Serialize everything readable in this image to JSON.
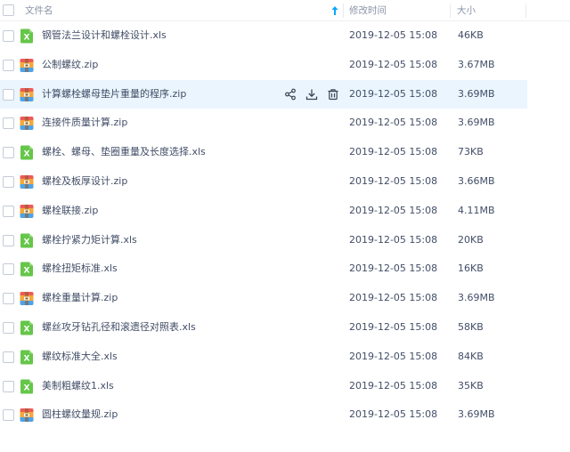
{
  "header": {
    "name_label": "文件名",
    "time_label": "修改时间",
    "size_label": "大小",
    "sort_icon": "sort-ascending-arrow-icon",
    "accent_color": "#06a7ff"
  },
  "icons": {
    "xls": {
      "letter": "X",
      "color": "#65c649"
    },
    "zip": {
      "color": "#f3a83b"
    }
  },
  "files": [
    {
      "name": "钢管法兰设计和螺栓设计.xls",
      "type": "xls",
      "modified": "2019-12-05 15:08",
      "size": "46KB"
    },
    {
      "name": "公制螺纹.zip",
      "type": "zip",
      "modified": "2019-12-05 15:08",
      "size": "3.67MB"
    },
    {
      "name": "计算螺栓螺母垫片重量的程序.zip",
      "type": "zip",
      "modified": "2019-12-05 15:08",
      "size": "3.69MB",
      "hover": true
    },
    {
      "name": "连接件质量计算.zip",
      "type": "zip",
      "modified": "2019-12-05 15:08",
      "size": "3.69MB"
    },
    {
      "name": "螺栓、螺母、垫圈重量及长度选择.xls",
      "type": "xls",
      "modified": "2019-12-05 15:08",
      "size": "73KB"
    },
    {
      "name": "螺栓及板厚设计.zip",
      "type": "zip",
      "modified": "2019-12-05 15:08",
      "size": "3.66MB"
    },
    {
      "name": "螺栓联接.zip",
      "type": "zip",
      "modified": "2019-12-05 15:08",
      "size": "4.11MB"
    },
    {
      "name": "螺栓拧紧力矩计算.xls",
      "type": "xls",
      "modified": "2019-12-05 15:08",
      "size": "20KB"
    },
    {
      "name": "螺栓扭矩标准.xls",
      "type": "xls",
      "modified": "2019-12-05 15:08",
      "size": "16KB"
    },
    {
      "name": "螺栓重量计算.zip",
      "type": "zip",
      "modified": "2019-12-05 15:08",
      "size": "3.69MB"
    },
    {
      "name": "螺丝攻牙钻孔径和滚遗径对照表.xls",
      "type": "xls",
      "modified": "2019-12-05 15:08",
      "size": "58KB"
    },
    {
      "name": "螺纹标准大全.xls",
      "type": "xls",
      "modified": "2019-12-05 15:08",
      "size": "84KB"
    },
    {
      "name": "美制粗螺纹1.xls",
      "type": "xls",
      "modified": "2019-12-05 15:08",
      "size": "35KB"
    },
    {
      "name": "圆柱螺纹量规.zip",
      "type": "zip",
      "modified": "2019-12-05 15:08",
      "size": "3.69MB"
    }
  ],
  "row_actions": [
    "share-icon",
    "download-icon",
    "delete-icon"
  ]
}
